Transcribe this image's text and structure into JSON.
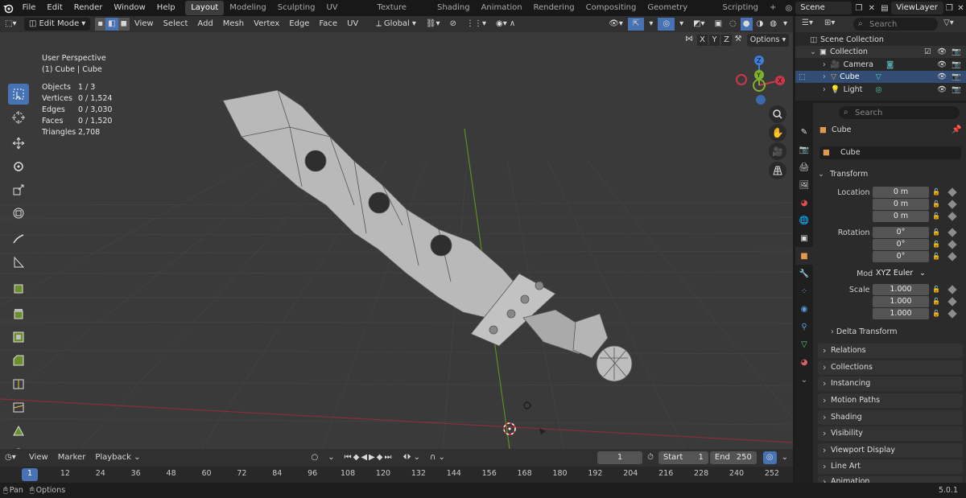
{
  "topbar": {
    "menus": [
      "File",
      "Edit",
      "Render",
      "Window",
      "Help"
    ],
    "workspaces": [
      "Layout",
      "Modeling",
      "Sculpting",
      "UV Editing",
      "Texture Paint",
      "Shading",
      "Animation",
      "Rendering",
      "Compositing",
      "Geometry Nodes",
      "Scripting"
    ],
    "active_workspace": "Layout",
    "add_tab": "+",
    "scene": "Scene",
    "view_layer": "ViewLayer"
  },
  "viewport_header": {
    "mode": "Edit Mode",
    "menus": [
      "View",
      "Select",
      "Add",
      "Mesh",
      "Vertex",
      "Edge",
      "Face",
      "UV"
    ],
    "orientation": "Global",
    "axes": [
      "X",
      "Y",
      "Z"
    ],
    "options": "Options"
  },
  "overlay": {
    "view_name": "User Perspective",
    "object_name": "(1) Cube | Cube",
    "stats": [
      {
        "k": "Objects",
        "v": "1 / 3"
      },
      {
        "k": "Vertices",
        "v": "0 / 1,524"
      },
      {
        "k": "Edges",
        "v": "0 / 3,030"
      },
      {
        "k": "Faces",
        "v": "0 / 1,520"
      },
      {
        "k": "Triangles",
        "v": "2,708"
      }
    ],
    "gizmo": {
      "x": "X",
      "y": "Y",
      "z": "Z"
    }
  },
  "outliner": {
    "search_placeholder": "Search",
    "scene_collection": "Scene Collection",
    "collection": "Collection",
    "items": [
      "Camera",
      "Cube",
      "Light"
    ],
    "selected": "Cube"
  },
  "properties": {
    "search_placeholder": "Search",
    "object_name": "Cube",
    "datablock": "Cube",
    "transform_title": "Transform",
    "location": {
      "label": "Location X",
      "y": "Y",
      "z": "Z",
      "vx": "0 m",
      "vy": "0 m",
      "vz": "0 m"
    },
    "rotation": {
      "label": "Rotation X",
      "y": "Y",
      "z": "Z",
      "vx": "0°",
      "vy": "0°",
      "vz": "0°"
    },
    "mode": {
      "label": "Mode",
      "value": "XYZ Euler"
    },
    "scale": {
      "label": "Scale X",
      "y": "Y",
      "z": "Z",
      "vx": "1.000",
      "vy": "1.000",
      "vz": "1.000"
    },
    "delta_transform": "Delta Transform",
    "panels": [
      "Relations",
      "Collections",
      "Instancing",
      "Motion Paths",
      "Shading",
      "Visibility",
      "Viewport Display",
      "Line Art",
      "Animation"
    ]
  },
  "timeline": {
    "menus": [
      "View",
      "Marker",
      "Playback"
    ],
    "current_frame": "1",
    "start_label": "Start",
    "start": "1",
    "end_label": "End",
    "end": "250",
    "ruler": [
      "1",
      "12",
      "24",
      "36",
      "48",
      "60",
      "72",
      "84",
      "96",
      "108",
      "120",
      "132",
      "144",
      "156",
      "168",
      "180",
      "192",
      "204",
      "216",
      "228",
      "240",
      "252"
    ]
  },
  "statusbar": {
    "pan": "Pan",
    "options": "Options",
    "version": "5.0.1"
  },
  "colors": {
    "accent": "#4772b3",
    "x_axis": "#c9394b",
    "y_axis": "#7fb22c",
    "z_axis": "#3f7ed8",
    "mesh": "#b8b8b8",
    "viewport_bg": "#3a3a3a"
  }
}
